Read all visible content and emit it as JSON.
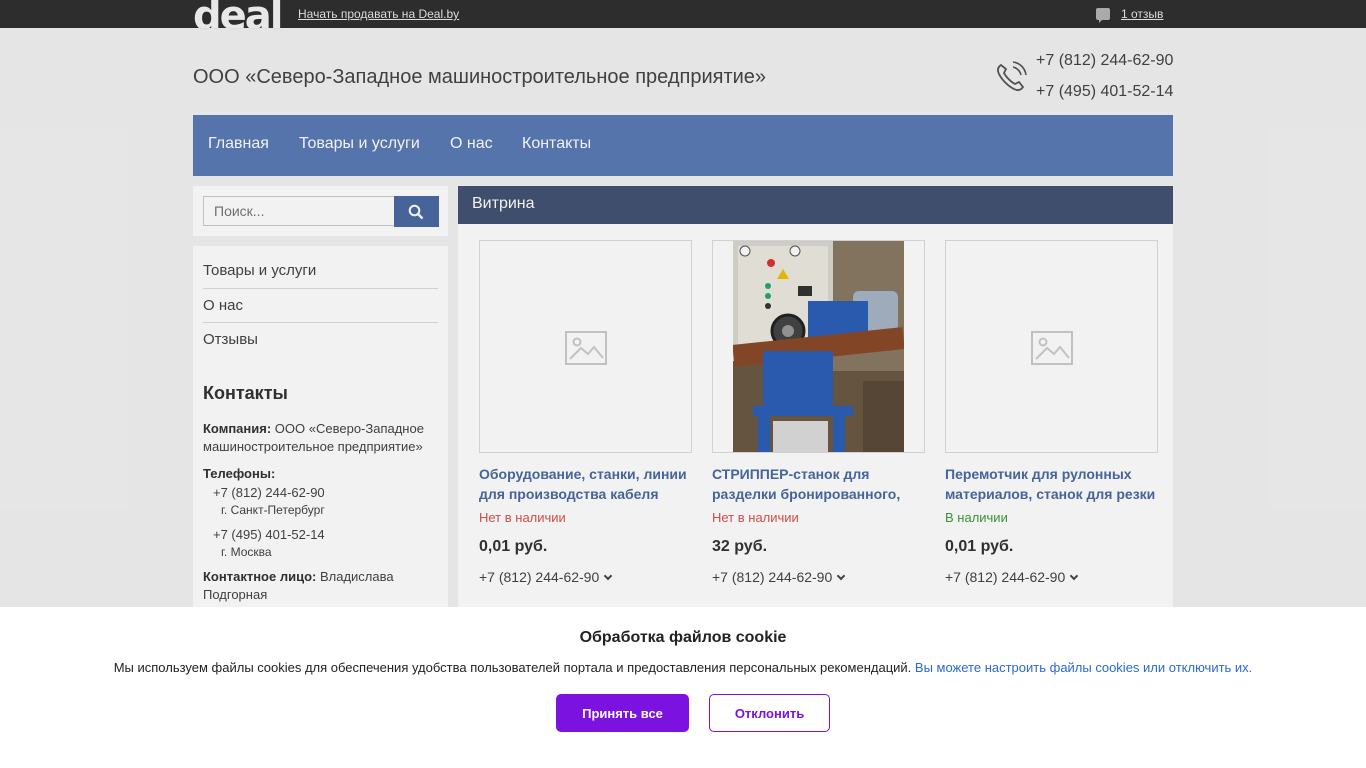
{
  "topbar": {
    "logo": "deal",
    "sell_link": "Начать продавать на Deal.by",
    "reviews_link": "1 отзыв"
  },
  "header": {
    "company_title": "ООО «Северо-Западное машиностроительное предприятие»",
    "phones": [
      "+7 (812) 244-62-90",
      "+7 (495) 401-52-14"
    ]
  },
  "nav": {
    "items": [
      "Главная",
      "Товары и услуги",
      "О нас",
      "Контакты"
    ]
  },
  "sidebar": {
    "search_placeholder": "Поиск...",
    "menu": [
      "Товары и услуги",
      "О нас",
      "Отзывы"
    ],
    "contacts": {
      "heading": "Контакты",
      "company_label": "Компания:",
      "company_value": "ООО «Северо-Западное машиностроительное предприятие»",
      "phones_label": "Телефоны:",
      "phone1": "+7 (812) 244-62-90",
      "city1": "г. Санкт-Петербург",
      "phone2": "+7 (495) 401-52-14",
      "city2": "г. Москва",
      "person_label": "Контактное лицо:",
      "person_value": "Владислава Подгорная"
    }
  },
  "main": {
    "header": "Витрина",
    "products": [
      {
        "title": "Оборудование, станки, линии для производства кабеля",
        "status": "Нет в наличии",
        "status_color": "#d9534f",
        "price": "0,01 руб.",
        "phone": "+7 (812) 244-62-90",
        "image": "placeholder-icon"
      },
      {
        "title": "СТРИППЕР-станок для разделки бронированного,",
        "status": "Нет в наличии",
        "status_color": "#d9534f",
        "price": "32 руб.",
        "phone": "+7 (812) 244-62-90",
        "image": "machine-photo"
      },
      {
        "title": "Перемотчик для рулонных материалов, станок для резки",
        "status": "В наличии",
        "status_color": "#3c9a3c",
        "price": "0,01 руб.",
        "phone": "+7 (812) 244-62-90",
        "image": "placeholder-icon"
      }
    ]
  },
  "cookie": {
    "title": "Обработка файлов cookie",
    "text": "Мы используем файлы cookies для обеспечения удобства пользователей портала и предоставления персональных рекомендаций.",
    "link": "Вы можете настроить файлы cookies или отключить их.",
    "accept": "Принять все",
    "decline": "Отклонить"
  }
}
